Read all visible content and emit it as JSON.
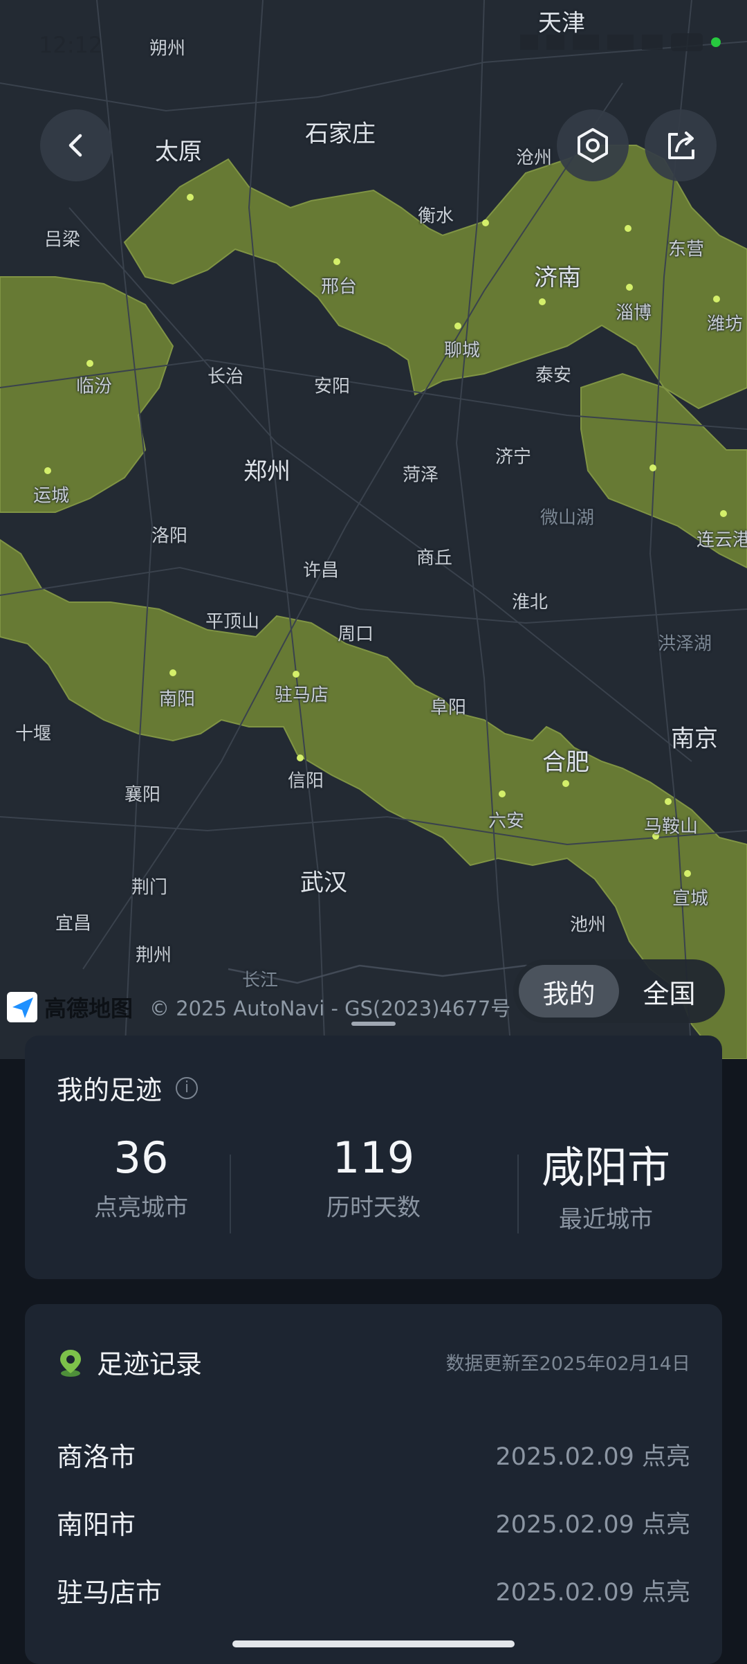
{
  "status_bar": {
    "time": "12:12"
  },
  "map": {
    "cities": [
      {
        "name": "天津",
        "big": true
      },
      {
        "name": "朔州"
      },
      {
        "name": "石家庄",
        "big": true
      },
      {
        "name": "太原",
        "big": true
      },
      {
        "name": "沧州"
      },
      {
        "name": "衡水"
      },
      {
        "name": "东营"
      },
      {
        "name": "吕梁"
      },
      {
        "name": "邢台"
      },
      {
        "name": "济南",
        "big": true
      },
      {
        "name": "淄博"
      },
      {
        "name": "潍坊"
      },
      {
        "name": "聊城"
      },
      {
        "name": "临汾"
      },
      {
        "name": "长治"
      },
      {
        "name": "安阳"
      },
      {
        "name": "泰安"
      },
      {
        "name": "运城"
      },
      {
        "name": "郑州",
        "big": true
      },
      {
        "name": "菏泽"
      },
      {
        "name": "济宁"
      },
      {
        "name": "微山湖",
        "water": true
      },
      {
        "name": "连云港"
      },
      {
        "name": "洛阳"
      },
      {
        "name": "许昌"
      },
      {
        "name": "商丘"
      },
      {
        "name": "淮北"
      },
      {
        "name": "平顶山"
      },
      {
        "name": "周口"
      },
      {
        "name": "洪泽湖",
        "water": true
      },
      {
        "name": "南阳"
      },
      {
        "name": "驻马店"
      },
      {
        "name": "阜阳"
      },
      {
        "name": "十堰"
      },
      {
        "name": "南京",
        "big": true
      },
      {
        "name": "合肥",
        "big": true
      },
      {
        "name": "襄阳"
      },
      {
        "name": "信阳"
      },
      {
        "name": "六安"
      },
      {
        "name": "马鞍山"
      },
      {
        "name": "荆门"
      },
      {
        "name": "武汉",
        "big": true
      },
      {
        "name": "宣城"
      },
      {
        "name": "宜昌"
      },
      {
        "name": "池州"
      },
      {
        "name": "荆州"
      },
      {
        "name": "长江",
        "water": true
      }
    ],
    "toggle": {
      "mine": "我的",
      "national": "全国",
      "selected": "我的"
    },
    "attribution": {
      "logo": "高德地图",
      "copyright": "© 2025 AutoNavi - GS(2023)4677号"
    },
    "highlight_color": "#6b7f35"
  },
  "summary": {
    "title": "我的足迹",
    "stats": [
      {
        "value": "36",
        "label": "点亮城市"
      },
      {
        "value": "119",
        "label": "历时天数"
      },
      {
        "value": "咸阳市",
        "label": "最近城市"
      }
    ]
  },
  "records": {
    "title": "足迹记录",
    "updated": "数据更新至2025年02月14日",
    "items": [
      {
        "city": "商洛市",
        "date": "2025.02.09 点亮"
      },
      {
        "city": "南阳市",
        "date": "2025.02.09 点亮"
      },
      {
        "city": "驻马店市",
        "date": "2025.02.09 点亮"
      }
    ]
  }
}
